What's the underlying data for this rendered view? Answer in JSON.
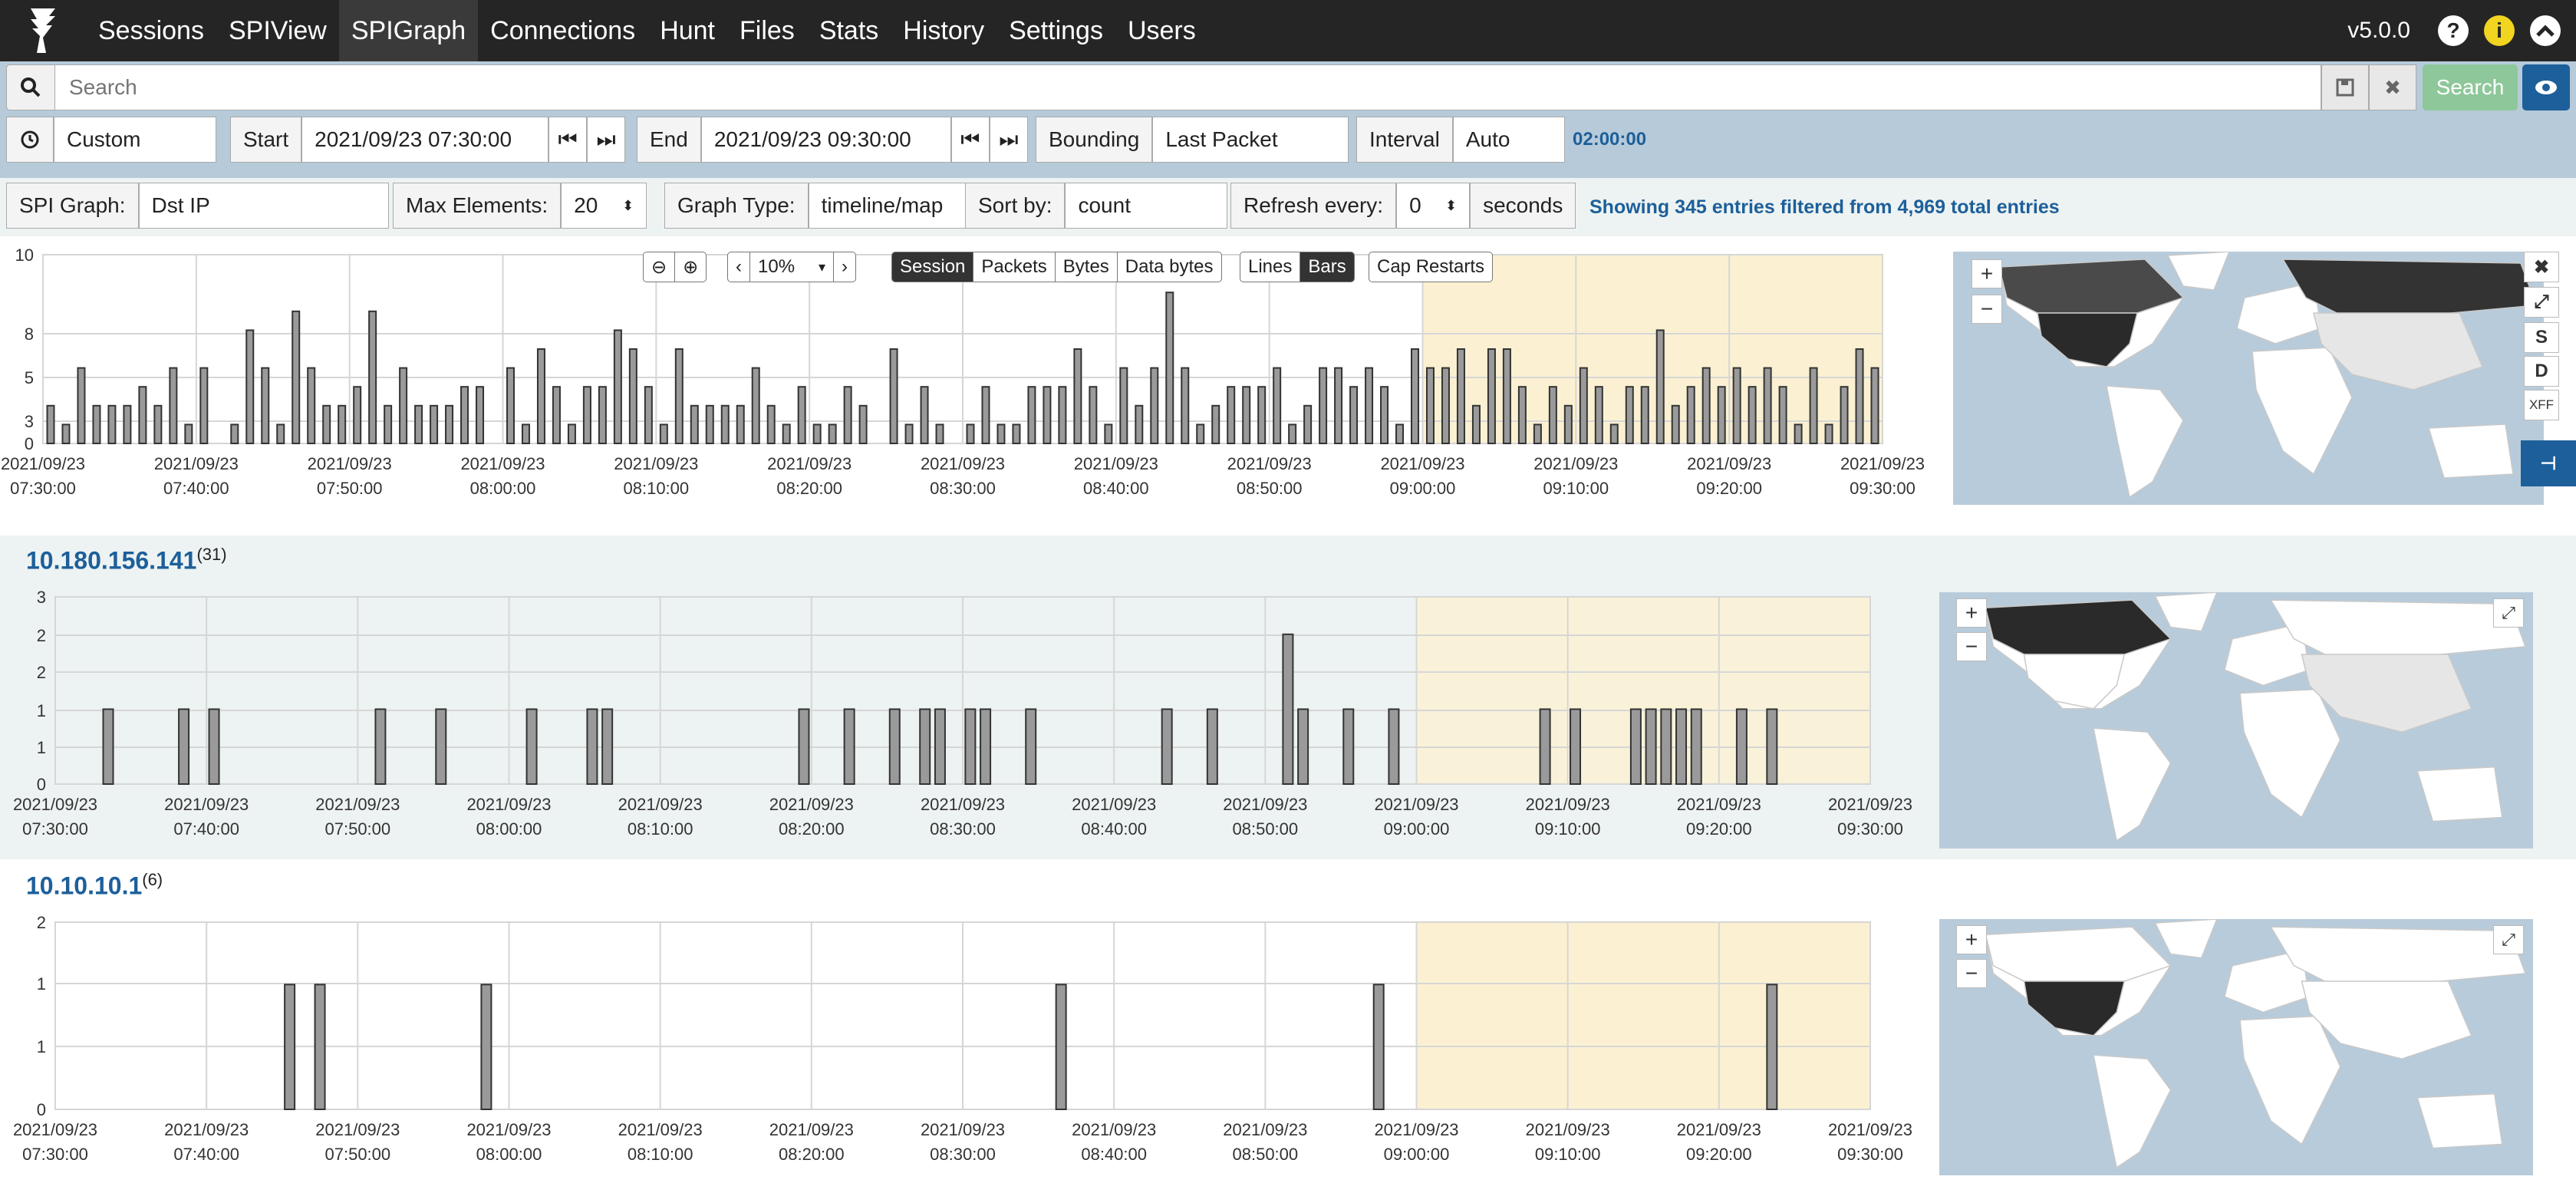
{
  "nav": {
    "items": [
      "Sessions",
      "SPIView",
      "SPIGraph",
      "Connections",
      "Hunt",
      "Files",
      "Stats",
      "History",
      "Settings",
      "Users"
    ],
    "active": "SPIGraph",
    "version": "v5.0.0",
    "help_glyph": "?",
    "info_glyph": "i"
  },
  "search": {
    "placeholder": "Search",
    "button": "Search"
  },
  "time": {
    "range": "Custom",
    "start_label": "Start",
    "start": "2021/09/23 07:30:00",
    "end_label": "End",
    "end": "2021/09/23 09:30:00",
    "bounding_label": "Bounding",
    "bounding": "Last Packet",
    "interval_label": "Interval",
    "interval": "Auto",
    "duration": "02:00:00"
  },
  "spigraph": {
    "field_label": "SPI Graph:",
    "field": "Dst IP",
    "max_label": "Max Elements:",
    "max": "20",
    "type_label": "Graph Type:",
    "type": "timeline/map",
    "sort_label": "Sort by:",
    "sort": "count",
    "refresh_label": "Refresh every:",
    "refresh": "0",
    "refresh_unit": "seconds",
    "showing": "Showing 345 entries filtered from 4,969 total entries"
  },
  "chart_controls": {
    "zoom": "10%",
    "metrics": [
      "Session",
      "Packets",
      "Bytes",
      "Data bytes"
    ],
    "metric_active": "Session",
    "styles": [
      "Lines",
      "Bars"
    ],
    "style_active": "Bars",
    "cap": "Cap Restarts"
  },
  "map_controls": {
    "s": "S",
    "d": "D",
    "xff": "XFF"
  },
  "x_ticks": [
    [
      "2021/09/23",
      "07:30:00"
    ],
    [
      "2021/09/23",
      "07:40:00"
    ],
    [
      "2021/09/23",
      "07:50:00"
    ],
    [
      "2021/09/23",
      "08:00:00"
    ],
    [
      "2021/09/23",
      "08:10:00"
    ],
    [
      "2021/09/23",
      "08:20:00"
    ],
    [
      "2021/09/23",
      "08:30:00"
    ],
    [
      "2021/09/23",
      "08:40:00"
    ],
    [
      "2021/09/23",
      "08:50:00"
    ],
    [
      "2021/09/23",
      "09:00:00"
    ],
    [
      "2021/09/23",
      "09:10:00"
    ],
    [
      "2021/09/23",
      "09:20:00"
    ],
    [
      "2021/09/23",
      "09:30:00"
    ]
  ],
  "sections": [
    {
      "title": "10.180.156.141",
      "count": "(31)"
    },
    {
      "title": "10.10.10.1",
      "count": "(6)"
    }
  ],
  "chart_data": [
    {
      "type": "bar",
      "title": "",
      "x_range": [
        "07:30",
        "09:30"
      ],
      "x_unit": "minutes after 2021/09/23 07:30",
      "ytick_labels": [
        "0",
        "3",
        "5",
        "8",
        "10"
      ],
      "ylim": [
        0,
        10
      ],
      "highlight_range": [
        "09:00",
        "09:30"
      ],
      "x": [
        0,
        1,
        2,
        3,
        4,
        5,
        6,
        7,
        8,
        9,
        10,
        12,
        13,
        14,
        15,
        16,
        17,
        18,
        19,
        20,
        21,
        22,
        23,
        24,
        25,
        26,
        27,
        28,
        30,
        31,
        32,
        33,
        34,
        35,
        36,
        37,
        38,
        39,
        40,
        41,
        42,
        43,
        44,
        45,
        46,
        47,
        48,
        49,
        50,
        51,
        52,
        53,
        55,
        56,
        57,
        58,
        60,
        61,
        62,
        63,
        64,
        65,
        66,
        67,
        68,
        69,
        70,
        71,
        72,
        73,
        74,
        75,
        76,
        77,
        78,
        79,
        80,
        81,
        82,
        83,
        84,
        85,
        86,
        87,
        88,
        89,
        90,
        91,
        92,
        93,
        94,
        95,
        96,
        97,
        98,
        99,
        100,
        101,
        102,
        103,
        104,
        105,
        106,
        107,
        108,
        109,
        110,
        111,
        112,
        113,
        114,
        115,
        116,
        117,
        118,
        119
      ],
      "values": [
        2,
        1,
        4,
        2,
        2,
        2,
        3,
        2,
        4,
        1,
        4,
        1,
        6,
        4,
        1,
        7,
        4,
        2,
        2,
        3,
        7,
        2,
        4,
        2,
        2,
        2,
        3,
        3,
        4,
        1,
        5,
        3,
        1,
        3,
        3,
        6,
        5,
        3,
        1,
        5,
        2,
        2,
        2,
        2,
        4,
        2,
        1,
        3,
        1,
        1,
        3,
        2,
        5,
        1,
        3,
        1,
        1,
        3,
        1,
        1,
        3,
        3,
        3,
        5,
        3,
        1,
        4,
        2,
        4,
        8,
        4,
        1,
        2,
        3,
        3,
        3,
        4,
        1,
        2,
        4,
        4,
        3,
        4,
        3,
        1,
        5,
        4,
        4,
        5,
        2,
        5,
        5,
        3,
        1,
        3,
        2,
        4,
        3,
        1,
        3,
        3,
        6,
        2,
        3,
        4,
        3,
        4,
        3,
        4,
        3,
        1,
        4,
        1,
        3,
        5,
        4,
        3,
        1,
        3,
        2
      ],
      "series": [
        {
          "name": "Session",
          "values": []
        }
      ]
    },
    {
      "type": "bar",
      "title": "10.180.156.141",
      "x_unit": "minutes after 2021/09/23 07:30",
      "ytick_labels": [
        "0",
        "1",
        "1",
        "2",
        "2",
        "3"
      ],
      "ylim": [
        0,
        2.5
      ],
      "highlight_range": [
        "09:00",
        "09:30"
      ],
      "x": [
        3,
        8,
        10,
        21,
        25,
        31,
        35,
        36,
        49,
        52,
        55,
        57,
        58,
        60,
        61,
        64,
        73,
        76,
        81,
        82,
        85,
        88,
        98,
        100,
        104,
        105,
        106,
        107,
        108,
        111,
        113
      ],
      "values": [
        1,
        1,
        1,
        1,
        1,
        1,
        1,
        1,
        1,
        1,
        1,
        1,
        1,
        1,
        1,
        1,
        1,
        1,
        2,
        1,
        1,
        1,
        1,
        1,
        1,
        1,
        1,
        1,
        1,
        1,
        1
      ]
    },
    {
      "type": "bar",
      "title": "10.10.10.1",
      "x_unit": "minutes after 2021/09/23 07:30",
      "ytick_labels": [
        "0",
        "1",
        "1",
        "2"
      ],
      "ylim": [
        0,
        1.5
      ],
      "highlight_range": [
        "09:00",
        "09:30"
      ],
      "x": [
        15,
        17,
        28,
        66,
        87,
        113
      ],
      "values": [
        1,
        1,
        1,
        1,
        1,
        1
      ]
    }
  ]
}
